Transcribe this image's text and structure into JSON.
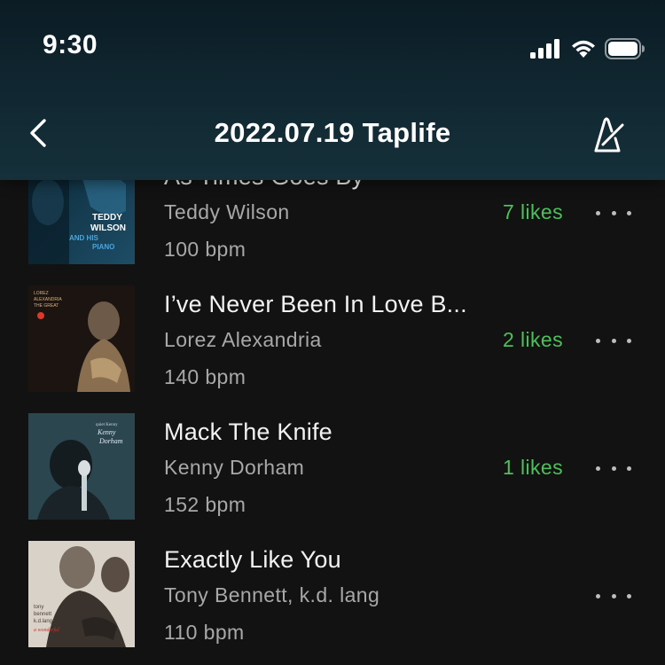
{
  "status_bar": {
    "time": "9:30",
    "icons": [
      "signal-icon",
      "wifi-icon",
      "battery-icon"
    ]
  },
  "nav": {
    "back_icon": "chevron-left-icon",
    "title": "2022.07.19 Taplife",
    "action_icon": "metronome-icon"
  },
  "colors": {
    "header_bg": "#112832",
    "page_bg": "#121212",
    "likes_green": "#4cc05a",
    "secondary_text": "#a8a8a8"
  },
  "tracks": [
    {
      "title": "As Times Goes By",
      "artist": "Teddy Wilson",
      "bpm": "100 bpm",
      "likes": "7 likes",
      "cover_text": [
        "TEDDY",
        "WILSON",
        "AND HIS",
        "PIANO"
      ]
    },
    {
      "title": "I’ve Never Been In Love B...",
      "artist": "Lorez Alexandria",
      "bpm": "140 bpm",
      "likes": "2 likes",
      "cover_text": [
        "LOREZ",
        "ALEXANDRIA",
        "THE GREAT"
      ]
    },
    {
      "title": "Mack The Knife",
      "artist": "Kenny Dorham",
      "bpm": "152 bpm",
      "likes": "1 likes",
      "cover_text": [
        "quiet Kenny",
        "Kenny",
        "Dorham"
      ]
    },
    {
      "title": "Exactly Like You",
      "artist": "Tony Bennett, k.d. lang",
      "bpm": "110 bpm",
      "likes": "",
      "cover_text": [
        "tony",
        "bennett",
        "k.d.lang",
        "a wonderful"
      ]
    }
  ]
}
